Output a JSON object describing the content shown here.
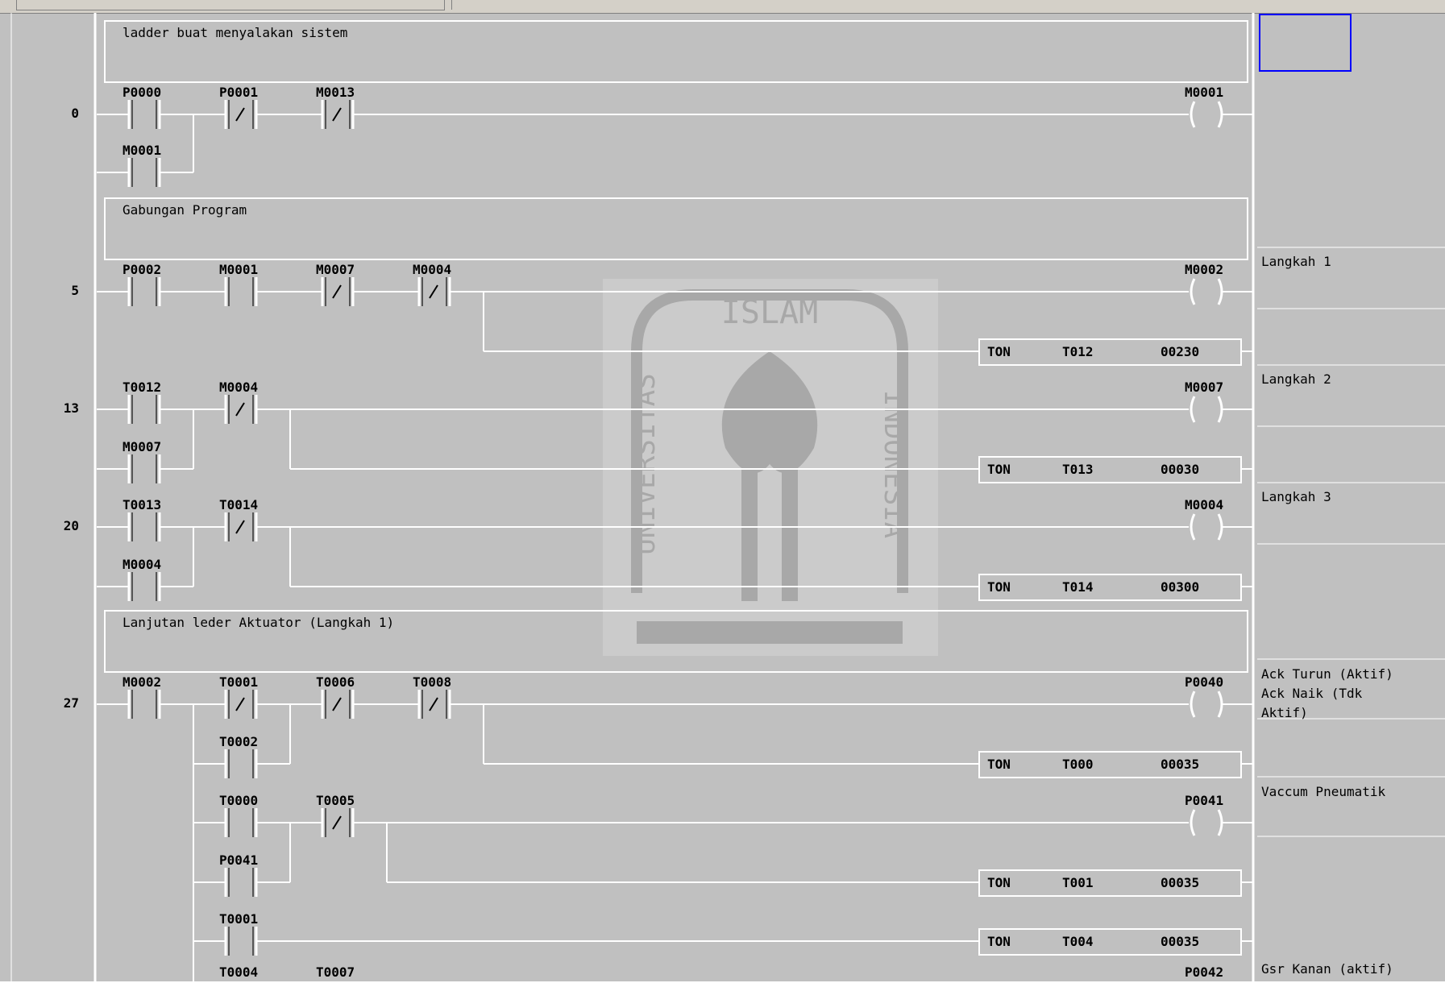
{
  "comments": [
    "ladder buat menyalakan sistem",
    "Gabungan Program",
    "Lanjutan leder Aktuator (Langkah 1)"
  ],
  "step_numbers": [
    "0",
    "5",
    "13",
    "20",
    "27"
  ],
  "rung0": {
    "contacts": [
      "P0000",
      "P0001",
      "M0013",
      "M0001"
    ],
    "coil": "M0001"
  },
  "rung5": {
    "contacts": [
      "P0002",
      "M0001",
      "M0007",
      "M0004"
    ],
    "coil": "M0002",
    "timer": {
      "type": "TON",
      "name": "T012",
      "value": "00230"
    }
  },
  "rung13": {
    "contacts": [
      "T0012",
      "M0004",
      "M0007"
    ],
    "coil": "M0007",
    "timer": {
      "type": "TON",
      "name": "T013",
      "value": "00030"
    }
  },
  "rung20": {
    "contacts": [
      "T0013",
      "T0014",
      "M0004"
    ],
    "coil": "M0004",
    "timer": {
      "type": "TON",
      "name": "T014",
      "value": "00300"
    }
  },
  "rung27": {
    "contacts": [
      "M0002",
      "T0001",
      "T0006",
      "T0008",
      "T0002"
    ],
    "coil": "P0040",
    "timer": {
      "type": "TON",
      "name": "T000",
      "value": "00035"
    }
  },
  "rung27b": {
    "contacts": [
      "T0000",
      "T0005",
      "P0041"
    ],
    "coil": "P0041",
    "timer": {
      "type": "TON",
      "name": "T001",
      "value": "00035"
    }
  },
  "rung27c": {
    "contacts": [
      "T0001"
    ],
    "timer": {
      "type": "TON",
      "name": "T004",
      "value": "00035"
    }
  },
  "rung27d": {
    "contacts": [
      "T0004",
      "T0007"
    ],
    "coil": "P0042"
  },
  "side_comments": [
    "Langkah 1",
    "Langkah 2",
    "Langkah 3",
    "Ack Turun (Aktif)",
    "Ack Naik (Tdk",
    "Aktif)",
    "Vaccum Pneumatik",
    "Gsr Kanan (aktif)"
  ],
  "watermark": {
    "top_text": "ISLAM",
    "left_text": "UNIVERSITAS",
    "right_text": "INDONESIA"
  },
  "colors": {
    "background": "#c0c0c0",
    "line": "#ffffff",
    "selection": "#0000ff"
  }
}
